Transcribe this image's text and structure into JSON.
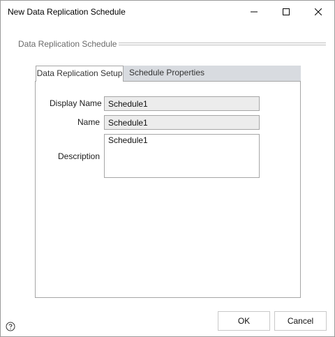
{
  "window": {
    "title": "New Data Replication Schedule",
    "controls": {
      "minimize": "minimize-icon",
      "maximize": "maximize-icon",
      "close": "close-icon"
    }
  },
  "section": {
    "label": "Data Replication Schedule"
  },
  "tabs": [
    {
      "label": "Data Replication Setup",
      "active": true
    },
    {
      "label": "Schedule Properties",
      "active": false
    }
  ],
  "form": {
    "display_name_label": "Display Name",
    "display_name_value": "Schedule1",
    "name_label": "Name",
    "name_value": "Schedule1",
    "description_label": "Description",
    "description_value": "Schedule1"
  },
  "footer": {
    "ok_label": "OK",
    "cancel_label": "Cancel",
    "help_icon": "help-icon"
  }
}
